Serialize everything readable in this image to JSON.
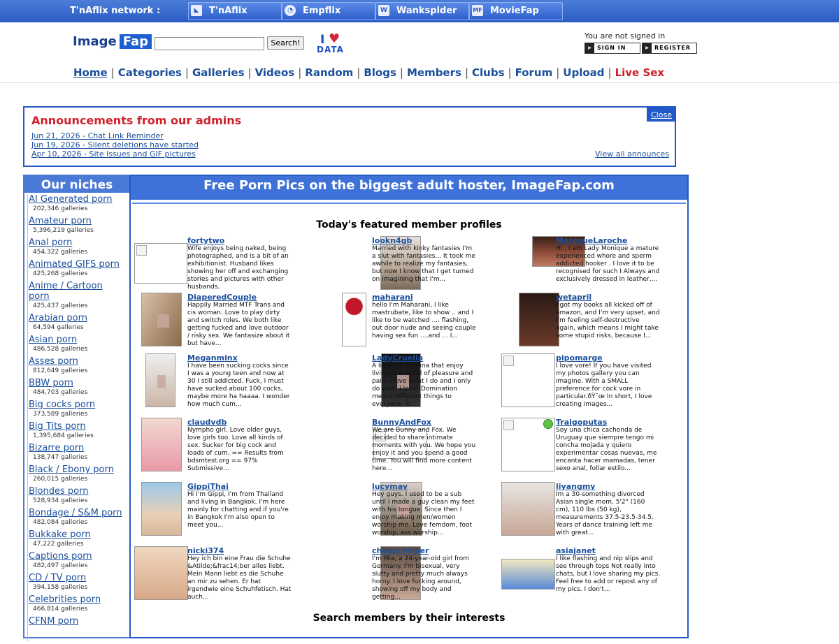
{
  "network": {
    "label": "T'nAflix network :",
    "tabs": [
      {
        "label": "T'nAflix",
        "icon": "tnaflix-icon"
      },
      {
        "label": "Empflix",
        "icon": "empflix-icon"
      },
      {
        "label": "Wankspider",
        "icon": "wankspider-icon",
        "glyph": "W"
      },
      {
        "label": "MovieFap",
        "icon": "moviefap-icon",
        "glyph": "MF"
      }
    ]
  },
  "header": {
    "logo_left": "Image",
    "logo_right": "Fap",
    "search_button": "Search!",
    "ilove_i": "I",
    "ilove_data": "DATA",
    "signed_text": "You are not signed in",
    "signin_label": "SIGN IN",
    "register_label": "REGISTER"
  },
  "nav": [
    "Home",
    "Categories",
    "Galleries",
    "Videos",
    "Random",
    "Blogs",
    "Members",
    "Clubs",
    "Forum",
    "Upload",
    "Live Sex"
  ],
  "announcements": {
    "title": "Announcements from our admins",
    "close": "Close",
    "view_all": "View all announces",
    "items": [
      "Jun 21, 2026 - Chat Link Reminder",
      "Jun 19, 2026 - Silent deletions have started",
      "Apr 10, 2026 - Site Issues and GIF pictures"
    ]
  },
  "sidebar": {
    "title": "Our niches",
    "niches": [
      {
        "name": "AI Generated porn",
        "count": "202,346 galleries"
      },
      {
        "name": "Amateur porn",
        "count": "5,396,219 galleries"
      },
      {
        "name": "Anal porn",
        "count": "454,322 galleries"
      },
      {
        "name": "Animated GIFS porn",
        "count": "425,268 galleries"
      },
      {
        "name": "Anime / Cartoon porn",
        "count": "425,437 galleries"
      },
      {
        "name": "Arabian porn",
        "count": "64,594 galleries"
      },
      {
        "name": "Asian porn",
        "count": "486,528 galleries"
      },
      {
        "name": "Asses porn",
        "count": "812,649 galleries"
      },
      {
        "name": "BBW porn",
        "count": "484,703 galleries"
      },
      {
        "name": "Big cocks porn",
        "count": "373,589 galleries"
      },
      {
        "name": "Big Tits porn",
        "count": "1,395,684 galleries"
      },
      {
        "name": "Bizarre porn",
        "count": "138,747 galleries"
      },
      {
        "name": "Black / Ebony porn",
        "count": "260,015 galleries"
      },
      {
        "name": "Blondes porn",
        "count": "528,934 galleries"
      },
      {
        "name": "Bondage / S&M porn",
        "count": "482,084 galleries"
      },
      {
        "name": "Bukkake porn",
        "count": "47,222 galleries"
      },
      {
        "name": "Captions porn",
        "count": "482,497 galleries"
      },
      {
        "name": "CD / TV porn",
        "count": "394,158 galleries"
      },
      {
        "name": "Celebrities porn",
        "count": "466,814 galleries"
      },
      {
        "name": "CFNM porn",
        "count": ""
      }
    ]
  },
  "main": {
    "title": "Free Porn Pics on the biggest adult hoster, ImageFap.com",
    "featured_title": "Today's featured member profiles",
    "search_interests": "Search members by their interests",
    "profiles": [
      {
        "name": "fortytwo",
        "desc": "Wife enjoys being naked, being photographed, and is a bit of an exhibitionist. Husband likes showing her off and exchanging stories and pictures with other husbands.",
        "thumb": "broken"
      },
      {
        "name": "lookn4gb",
        "desc": "Married with kinky fantasies I'm a slut with fantasies... It took me awhile to realize my fantasies, but now I know that I get turned on imagining that I'm...",
        "thumb": "photo"
      },
      {
        "name": "MoniqueLaroche",
        "desc": "Hi , I am Lady Monique a mature experienced whore and sperm addicted hooker . I love it to be recognised for such I Always and exclusively dressed in leather,...",
        "thumb": "photo"
      },
      {
        "name": "DiaperedCouple",
        "desc": "Happily Married MTF Trans and cis woman. Love to play dirty and switch roles. We both like getting fucked and love outdoor / risky sex. We fantasize about it but have...",
        "thumb": "photo"
      },
      {
        "name": "maharani",
        "desc": "hello I'm Maharani, I like mastrubate, like to show .. and I like to be watched .... flashing, out door nude and seeing couple having sex fun ....and ... I...",
        "thumb": "photo"
      },
      {
        "name": "wetapril",
        "desc": "I got my books all kicked off of amazon, and I'm very upset, and I'm feeling self-destructive again, which means I might take some stupid risks, because I...",
        "thumb": "photo"
      },
      {
        "name": "Meganminx",
        "desc": "I have been sucking cocks since I was a young teen and now at 30 I still addicted. Fuck, I must have sucked about 100 cocks, maybe more ha haaaa. I wonder how much cum...",
        "thumb": "photo"
      },
      {
        "name": "LadyCruella",
        "desc": "A lifestyle Domina that enjoy living in a world of pleasure and pain. I love what I do and I only do what I love! Domination means different things to everyone, it...",
        "thumb": "photo"
      },
      {
        "name": "pipomarge",
        "desc": "I love vore! If you have visited my photos gallery you can imagine. With a SMALL preference for cock vore in particular.ðŸ˜œ In short, I love creating images...",
        "thumb": "broken"
      },
      {
        "name": "claudvdb",
        "desc": "Nympho girl. Love older guys, love girls too. Love all kinds of sex. Sucker for big cock and loads of cum. == Results from bdsmtest.org == 97% Submissive...",
        "thumb": "photo"
      },
      {
        "name": "BunnyAndFox",
        "desc": "We are Bunny and Fox. We decided to share intimate moments with you. We hope you enjoy it and you spend a good time. You will find more content here...",
        "thumb": "broken"
      },
      {
        "name": "Traigoputas",
        "desc": "Soy una chica cachonda de Uruguay que siempre tengo mi concha mojada y quiero experimentar cosas nuevas, me encanta hacer mamadas, tener sexo anal, follar estilo...",
        "thumb": "broken"
      },
      {
        "name": "GippiThai",
        "desc": "Hi I'm Gippi, I'm from Thailand and living in Bangkok. I'm here mainly for chatting and if you're in Bangkok I'm also open to meet you...",
        "thumb": "photo"
      },
      {
        "name": "lucymay",
        "desc": "Hey guys. I used to be a sub until I made a guy clean my feet with his tongue. Since then I enjoy making men/women worship me. Love femdom, foot worship, ass worship...",
        "thumb": "photo"
      },
      {
        "name": "liyangmy",
        "desc": "Im a 30-something divorced Asian single mom, 5'2\" (160 cm), 110 lbs (50 kg), measurements 37.5-23.5-34.5. Years of dance training left me with great...",
        "thumb": "photo"
      },
      {
        "name": "nicki374",
        "desc": "Hey ich bin eine Frau die Schuhe &Atilde;&frac14;ber alles liebt. Mein Mann liebt es die Schuhe an mir zu sehen. Er hat irgendwie eine Schuhfetisch. Hat auch...",
        "thumb": "photo"
      },
      {
        "name": "cheapchirper",
        "desc": "I'm Mia, a 24-year-old girl from Germany. I'm bisexual, very slutty and pretty much always horny. I love fucking around, showing off my body and getting...",
        "thumb": "photo"
      },
      {
        "name": "asiajanet",
        "desc": "I like flashing and nip slips and see through tops Not really into chats, but I love sharing my pics. Feel free to add or repost any of my pics. I don't...",
        "thumb": "photo"
      }
    ]
  },
  "colors": {
    "brand": "#2358c8",
    "live": "#d0202a",
    "link": "#1a4f9c"
  }
}
